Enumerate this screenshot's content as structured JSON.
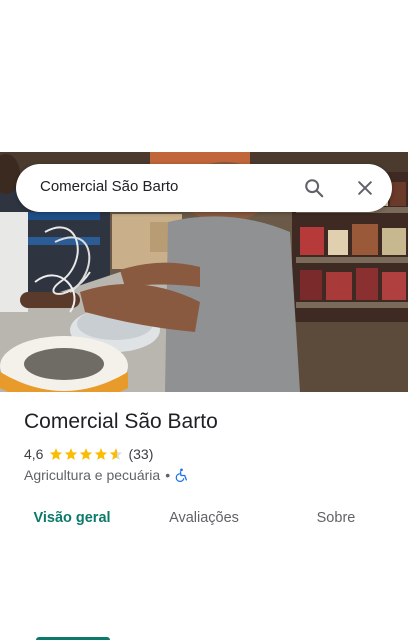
{
  "search": {
    "query": "Comercial São Barto"
  },
  "place": {
    "name": "Comercial São Barto",
    "rating": "4,6",
    "rating_value": 4.6,
    "review_count": "(33)",
    "category": "Agricultura e pecuária",
    "separator": "•",
    "accessibility_icon": "wheelchair-icon"
  },
  "tabs": [
    {
      "label": "Visão geral",
      "active": true
    },
    {
      "label": "Avaliações",
      "active": false
    },
    {
      "label": "Sobre",
      "active": false
    }
  ],
  "colors": {
    "accent": "#0b7a6a",
    "star": "#fbbc04",
    "accessibility": "#1a73e8"
  }
}
